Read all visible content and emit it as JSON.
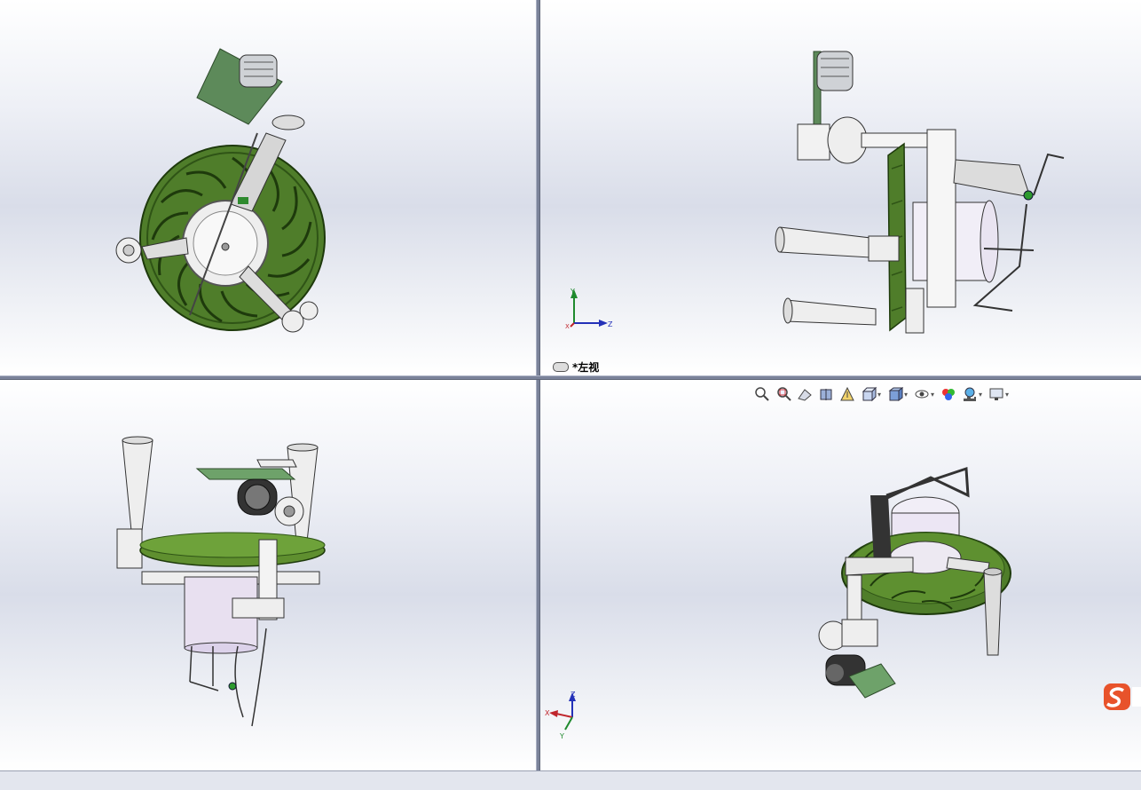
{
  "viewports": {
    "top_left": {
      "name": ""
    },
    "top_right": {
      "name": "*左视"
    },
    "bottom_left": {
      "name": ""
    },
    "bottom_right": {
      "name": ""
    }
  },
  "triads": {
    "top_right": {
      "y": "Y",
      "z": "Z",
      "x": "X"
    },
    "bottom_right": {
      "z": "Z",
      "x": "X",
      "y": "Y"
    }
  },
  "hud_toolbar": {
    "icons": [
      "zoom-to-fit-icon",
      "zoom-to-area-icon",
      "previous-view-icon",
      "section-view-icon",
      "dynamic-annotation-icon",
      "view-orientation-icon",
      "display-style-icon",
      "hide-show-items-icon",
      "edit-appearance-icon",
      "apply-scene-icon",
      "view-settings-icon"
    ]
  },
  "colors": {
    "background_top": "#ffffff",
    "background_mid": "#d9dde9",
    "disk_green": "#4f7d2a",
    "disk_dark": "#2f5416",
    "axis_x": "#c0262d",
    "axis_y": "#1f8a2e",
    "axis_z": "#2431b8",
    "ime_logo": "#e8532b"
  }
}
